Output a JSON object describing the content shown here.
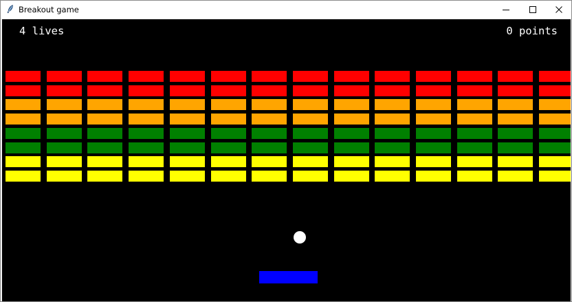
{
  "window": {
    "title": "Breakout game",
    "minimize_icon": "minimize-icon",
    "maximize_icon": "maximize-icon",
    "close_icon": "close-icon"
  },
  "hud": {
    "lives_text": "4 lives",
    "points_text": "0 points"
  },
  "game": {
    "lives": 4,
    "points": 0,
    "brick_columns": 14,
    "brick_rows": [
      {
        "color": "#ff0000"
      },
      {
        "color": "#ff0000"
      },
      {
        "color": "#ffa500"
      },
      {
        "color": "#ffa500"
      },
      {
        "color": "#008000"
      },
      {
        "color": "#008000"
      },
      {
        "color": "#ffff00"
      },
      {
        "color": "#ffff00"
      }
    ],
    "ball_color": "#ffffff",
    "paddle_color": "#0000ff",
    "background_color": "#000000"
  }
}
